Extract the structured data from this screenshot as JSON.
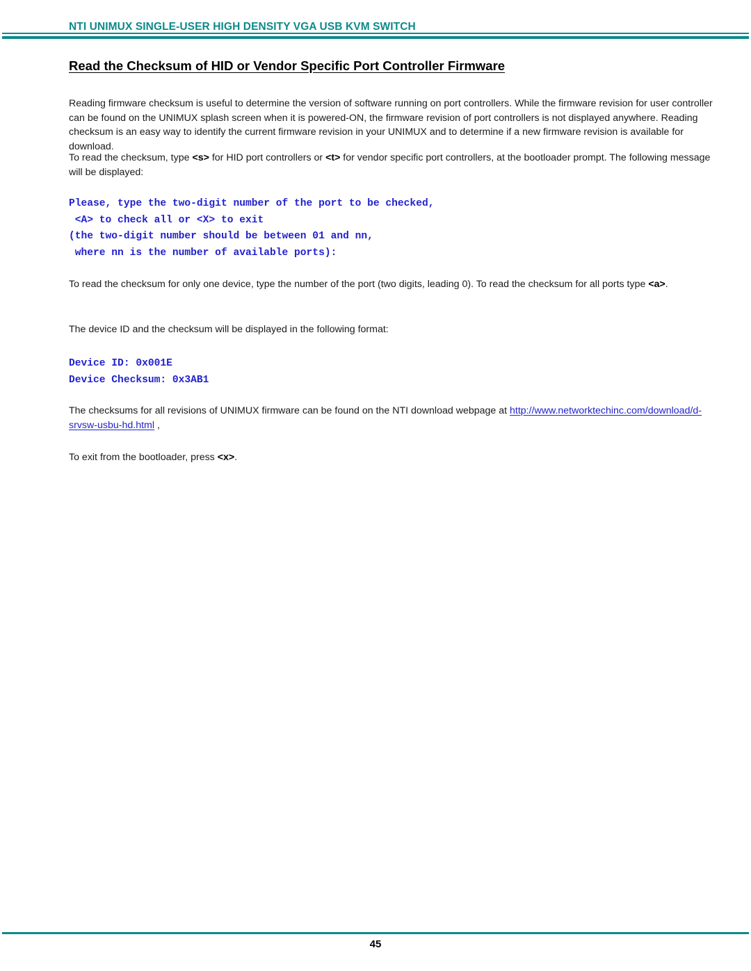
{
  "header": {
    "title": "NTI UNIMUX SINGLE-USER HIGH DENSITY VGA USB KVM SWITCH",
    "rule_color": "#0d8a8a"
  },
  "document": {
    "title": "Read the Checksum of HID or Vendor Specific Port Controller Firmware",
    "paragraph_1": "Reading firmware checksum is useful to determine the version of software running on port controllers. While the firmware revision for user controller can be found on the UNIMUX splash screen when it is powered-ON, the firmware revision of port controllers is not displayed anywhere. Reading checksum is an easy way to identify the current firmware revision in your UNIMUX and to determine if a new firmware revision is available for download.",
    "paragraph_2": {
      "part_1": "To read the checksum, type ",
      "key_s": "<s>",
      "part_2": " for HID port controllers or ",
      "key_t": "<t>",
      "part_3": " for vendor specific port controllers, at the bootloader prompt. The following message will be displayed:"
    },
    "prompt_code": {
      "line_1": "Please, type the two-digit number of the port to be checked,",
      "line_2": " <A> to check all or <X> to exit",
      "line_3": "(the two-digit number should be between 01 and nn,",
      "line_4": " where nn is the number of available ports):",
      "color": "#2222cc"
    },
    "paragraph_3": {
      "part_1": "To read the checksum for only one device, type the number of the port (two digits, leading 0). To read the checksum for all ports type ",
      "key_a": "<a>",
      "part_2": "."
    },
    "paragraph_4": "The device ID and the checksum will be displayed in the following format:",
    "device_code": {
      "line_1": "Device ID: 0x001E",
      "line_2": "Device Checksum: 0x3AB1",
      "color": "#2222cc"
    },
    "paragraph_5": {
      "part_1": "The checksums for all revisions of UNIMUX firmware can be found on the NTI download webpage at ",
      "link_text": "http://www.networktechinc.com/download/d-srvsw-usbu-hd.html",
      "part_2": " ,"
    },
    "paragraph_6": {
      "part_1": "To exit from the bootloader, press ",
      "key_x": "<x>",
      "part_2": "."
    }
  },
  "footer": {
    "page_number": "45"
  }
}
